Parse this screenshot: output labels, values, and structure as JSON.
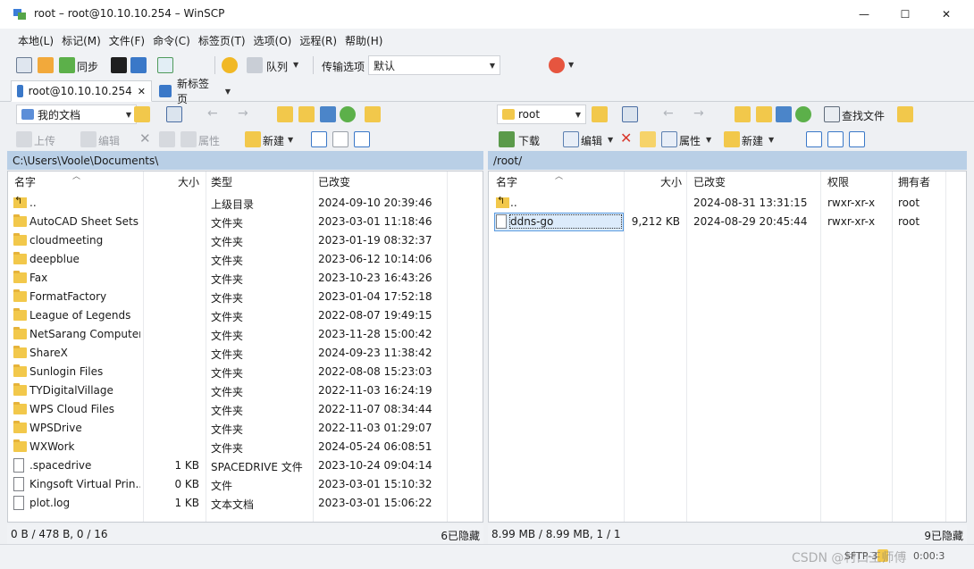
{
  "window": {
    "title": "root – root@10.10.10.254 – WinSCP",
    "minimize": "—",
    "maximize": "☐",
    "close": "✕"
  },
  "menu": [
    "本地(L)",
    "标记(M)",
    "文件(F)",
    "命令(C)",
    "标签页(T)",
    "选项(O)",
    "远程(R)",
    "帮助(H)"
  ],
  "toolbar": {
    "sync_label": "同步",
    "queue_label": "队列",
    "transfer_label": "传输选项",
    "transfer_value": "默认"
  },
  "tabs": {
    "session": "root@10.10.10.254",
    "new_tab": "新标签页"
  },
  "local": {
    "location": "我的文档",
    "path": "C:\\Users\\Voole\\Documents\\",
    "upload": "上传",
    "edit": "编辑",
    "properties": "属性",
    "new": "新建",
    "columns": {
      "name": "名字",
      "size": "大小",
      "type": "类型",
      "changed": "已改变"
    },
    "files": [
      {
        "icon": "up",
        "name": "..",
        "size": "",
        "type": "上级目录",
        "changed": "2024-09-10 20:39:46"
      },
      {
        "icon": "folder",
        "name": "AutoCAD Sheet Sets",
        "size": "",
        "type": "文件夹",
        "changed": "2023-03-01 11:18:46"
      },
      {
        "icon": "folder",
        "name": "cloudmeeting",
        "size": "",
        "type": "文件夹",
        "changed": "2023-01-19 08:32:37"
      },
      {
        "icon": "folder",
        "name": "deepblue",
        "size": "",
        "type": "文件夹",
        "changed": "2023-06-12 10:14:06"
      },
      {
        "icon": "folder",
        "name": "Fax",
        "size": "",
        "type": "文件夹",
        "changed": "2023-10-23 16:43:26"
      },
      {
        "icon": "folder",
        "name": "FormatFactory",
        "size": "",
        "type": "文件夹",
        "changed": "2023-01-04 17:52:18"
      },
      {
        "icon": "folder",
        "name": "League of Legends",
        "size": "",
        "type": "文件夹",
        "changed": "2022-08-07 19:49:15"
      },
      {
        "icon": "folder",
        "name": "NetSarang Computer",
        "size": "",
        "type": "文件夹",
        "changed": "2023-11-28 15:00:42"
      },
      {
        "icon": "folder",
        "name": "ShareX",
        "size": "",
        "type": "文件夹",
        "changed": "2024-09-23 11:38:42"
      },
      {
        "icon": "folder",
        "name": "Sunlogin Files",
        "size": "",
        "type": "文件夹",
        "changed": "2022-08-08 15:23:03"
      },
      {
        "icon": "folder",
        "name": "TYDigitalVillage",
        "size": "",
        "type": "文件夹",
        "changed": "2022-11-03 16:24:19"
      },
      {
        "icon": "folder",
        "name": "WPS Cloud Files",
        "size": "",
        "type": "文件夹",
        "changed": "2022-11-07 08:34:44"
      },
      {
        "icon": "folder",
        "name": "WPSDrive",
        "size": "",
        "type": "文件夹",
        "changed": "2022-11-03 01:29:07"
      },
      {
        "icon": "folder",
        "name": "WXWork",
        "size": "",
        "type": "文件夹",
        "changed": "2024-05-24 06:08:51"
      },
      {
        "icon": "file",
        "name": ".spacedrive",
        "size": "1 KB",
        "type": "SPACEDRIVE 文件",
        "changed": "2023-10-24 09:04:14"
      },
      {
        "icon": "file",
        "name": "Kingsoft Virtual Prin...",
        "size": "0 KB",
        "type": "文件",
        "changed": "2023-03-01 15:10:32"
      },
      {
        "icon": "file",
        "name": "plot.log",
        "size": "1 KB",
        "type": "文本文档",
        "changed": "2023-03-01 15:06:22"
      }
    ],
    "status_left": "0 B / 478 B,   0 / 16",
    "status_right": "6已隐藏"
  },
  "remote": {
    "location": "root",
    "path": "/root/",
    "download": "下载",
    "edit": "编辑",
    "properties": "属性",
    "new": "新建",
    "find": "查找文件",
    "columns": {
      "name": "名字",
      "size": "大小",
      "changed": "已改变",
      "rights": "权限",
      "owner": "拥有者"
    },
    "files": [
      {
        "icon": "up",
        "name": "..",
        "size": "",
        "changed": "2024-08-31 13:31:15",
        "rights": "rwxr-xr-x",
        "owner": "root"
      },
      {
        "icon": "file",
        "name": "ddns-go",
        "size": "9,212 KB",
        "changed": "2024-08-29 20:45:44",
        "rights": "rwxr-xr-x",
        "owner": "root"
      }
    ],
    "status_left": "8.99 MB / 8.99 MB,   1 / 1",
    "status_right": "9已隐藏"
  },
  "statusbar": {
    "protocol": "SFTP-3",
    "elapsed": "0:00:3",
    "watermark": "CSDN @村口王师傅"
  }
}
